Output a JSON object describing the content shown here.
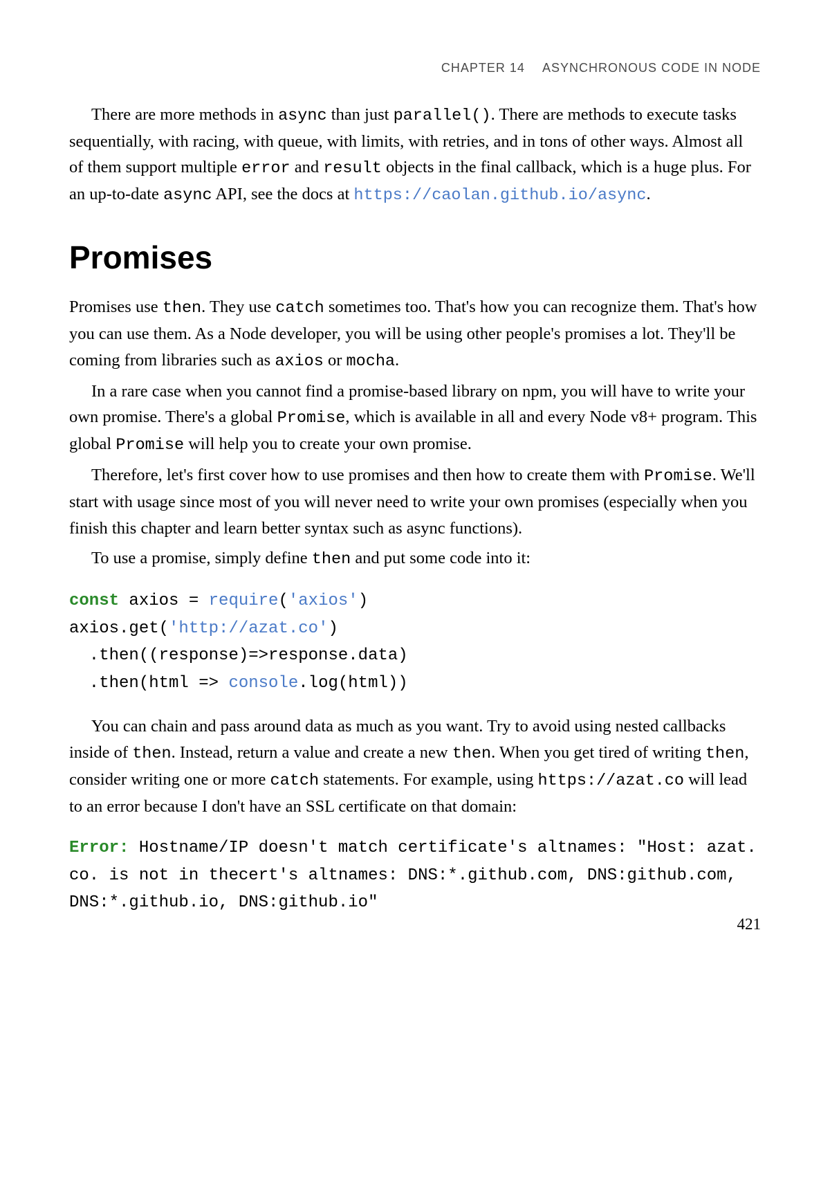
{
  "header": {
    "chapter": "CHAPTER 14",
    "title": "ASYNCHRONOUS CODE IN NODE"
  },
  "para1": {
    "pre1": "There are more methods in ",
    "code1": "async",
    "mid1": " than just ",
    "code2": "parallel()",
    "mid2": ". There are methods to execute tasks sequentially, with racing, with queue, with limits, with retries, and in tons of other ways. Almost all of them support multiple ",
    "code3": "error",
    "mid3": " and ",
    "code4": "result",
    "mid4": " objects in the final callback, which is a huge plus. For an up-to-date ",
    "code5": "async",
    "mid5": " API, see the docs at ",
    "link1": "https://caolan.github.io/async",
    "end": "."
  },
  "sectionTitle": "Promises",
  "para2": {
    "pre1": "Promises use ",
    "code1": "then",
    "mid1": ". They use ",
    "code2": "catch",
    "mid2": " sometimes too. That's how you can recognize them. That's how you can use them. As a Node developer, you will be using other people's promises a lot. They'll be coming from libraries such as ",
    "code3": "axios",
    "mid3": " or ",
    "code4": "mocha",
    "end": "."
  },
  "para3": {
    "pre1": "In a rare case when you cannot find a promise-based library on npm, you will have to write your own promise. There's a global ",
    "code1": "Promise",
    "mid1": ", which is available in all and every Node v8+ program. This global ",
    "code2": "Promise",
    "end": " will help you to create your own promise."
  },
  "para4": {
    "pre1": "Therefore, let's first cover how to use promises and then how to create them with ",
    "code1": "Promise",
    "end": ". We'll start with usage since most of you will never need to write your own promises (especially when you finish this chapter and learn better syntax such as async functions)."
  },
  "para5": {
    "pre1": "To use a promise, simply define ",
    "code1": "then",
    "end": " and put some code into it:"
  },
  "codeBlock1": {
    "line1_kw": "const",
    "line1_rest": " axios = ",
    "line1_func": "require",
    "line1_paren": "(",
    "line1_str": "'axios'",
    "line1_close": ")",
    "line2_pre": "axios.get(",
    "line2_str": "'http://azat.co'",
    "line2_close": ")",
    "line3": "  .then((response)=>response.data)",
    "line4_pre": "  .then(html => ",
    "line4_func": "console",
    "line4_rest": ".log(html))"
  },
  "para6": {
    "pre1": "You can chain and pass around data as much as you want. Try to avoid using nested callbacks inside of ",
    "code1": "then",
    "mid1": ". Instead, return a value and create a new ",
    "code2": "then",
    "mid2": ". When you get tired of writing ",
    "code3": "then",
    "mid3": ", consider writing one or more ",
    "code4": "catch",
    "mid4": " statements. For example, using ",
    "code5": "https://azat.co",
    "end": " will lead to an error because I don't have an SSL certificate on that domain:"
  },
  "codeBlock2": {
    "error_kw": "Error:",
    "rest": " Hostname/IP doesn't match certificate's altnames: \"Host: azat.\nco. is not in thecert's altnames: DNS:*.github.com, DNS:github.com,\nDNS:*.github.io, DNS:github.io\""
  },
  "pageNum": "421"
}
